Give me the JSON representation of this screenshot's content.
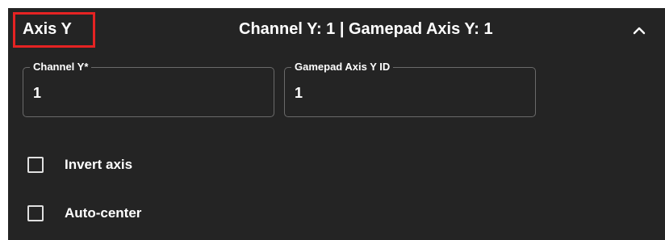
{
  "section": {
    "title": "Axis Y",
    "summary": "Channel Y: 1 | Gamepad Axis Y: 1",
    "collapse_icon": "chevron-up-icon",
    "highlight_color": "#e52323"
  },
  "fields": {
    "channel_y": {
      "label": "Channel Y*",
      "value": "1"
    },
    "gamepad_axis_y": {
      "label": "Gamepad Axis Y ID",
      "value": "1"
    }
  },
  "options": {
    "invert_axis": {
      "label": "Invert axis",
      "checked": false
    },
    "auto_center": {
      "label": "Auto-center",
      "checked": false
    }
  },
  "colors": {
    "panel_background": "#242424",
    "text": "#ffffff",
    "border": "#6a6a6a"
  }
}
